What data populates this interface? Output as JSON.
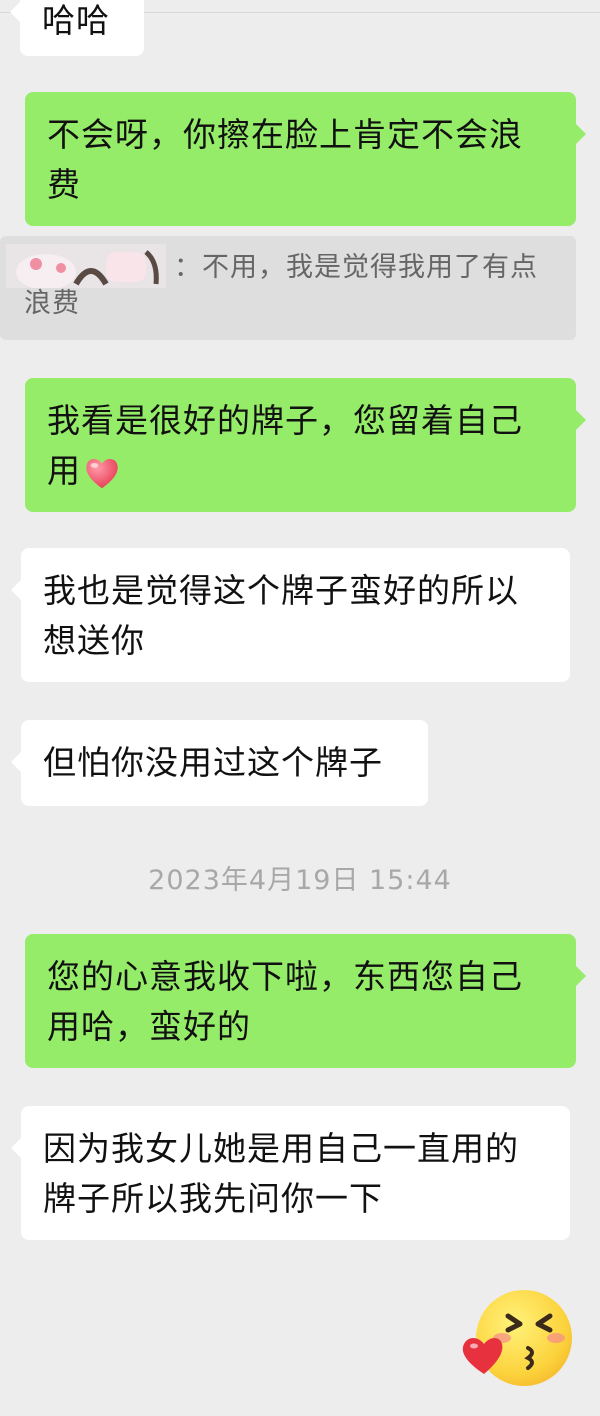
{
  "messages": [
    {
      "id": "b0",
      "side": "left",
      "text": "哈哈"
    },
    {
      "id": "b1",
      "side": "right",
      "line1": "不会呀，你擦在脸上肯定不会浪",
      "line2": "费"
    },
    {
      "id": "b2",
      "side": "right",
      "line1": "我看是很好的牌子，您留着自己",
      "line2": "用",
      "emoji": "red-heart"
    },
    {
      "id": "b3",
      "side": "left",
      "line1": "我也是觉得这个牌子蛮好的所以",
      "line2": "想送你"
    },
    {
      "id": "b4",
      "side": "left",
      "text": "但怕你没用过这个牌子"
    },
    {
      "id": "b5",
      "side": "right",
      "line1": "您的心意我收下啦，东西您自己",
      "line2": "用哈，蛮好的"
    },
    {
      "id": "b6",
      "side": "left",
      "line1": "因为我女儿她是用自己一直用的",
      "line2": "牌子所以我先问你一下"
    }
  ],
  "quote": {
    "line1": "：不用，我是觉得我用了有点",
    "line2": "浪费"
  },
  "timestamp": "2023年4月19日 15:44",
  "sticker": "kissing-face-with-heart",
  "colors": {
    "background": "#ededed",
    "self_bubble": "#95ec69",
    "other_bubble": "#ffffff",
    "quote_bg": "#dedede",
    "timestamp": "#a8a8a8"
  }
}
